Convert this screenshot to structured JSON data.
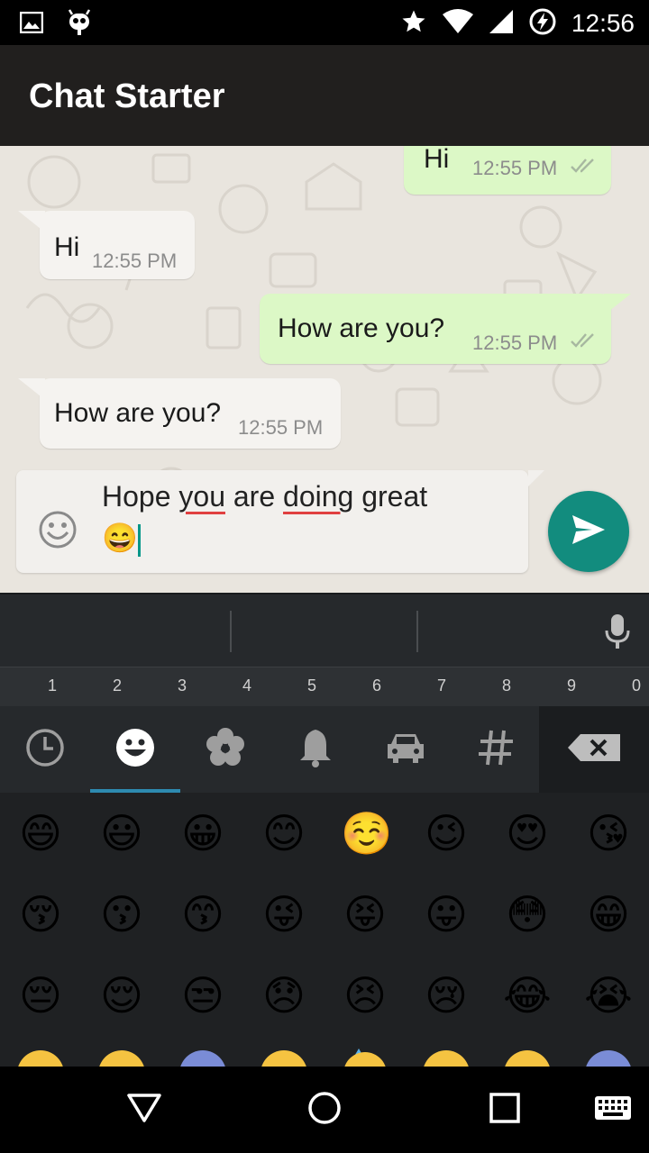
{
  "status_bar": {
    "time": "12:56",
    "icons": [
      "image-icon",
      "android-icon",
      "star-icon",
      "wifi-icon",
      "signal-icon",
      "battery-charging-icon"
    ]
  },
  "app_bar": {
    "title": "Chat Starter"
  },
  "messages": [
    {
      "direction": "outgoing",
      "text": "Hi",
      "time": "12:55 PM",
      "status": "read"
    },
    {
      "direction": "incoming",
      "text": "Hi",
      "time": "12:55 PM"
    },
    {
      "direction": "outgoing",
      "text": "How are you?",
      "time": "12:55 PM",
      "status": "read"
    },
    {
      "direction": "incoming",
      "text": "How are you?",
      "time": "12:55 PM"
    }
  ],
  "composer": {
    "words": [
      "Hope",
      "you",
      "are",
      "doing",
      "great"
    ],
    "emoji": "😄",
    "misspelled": [
      "you",
      "doing"
    ]
  },
  "keyboard": {
    "number_row": [
      "1",
      "2",
      "3",
      "4",
      "5",
      "6",
      "7",
      "8",
      "9",
      "0"
    ],
    "categories": [
      "recent-icon",
      "smiley-icon",
      "flower-icon",
      "bell-icon",
      "car-icon",
      "hash-icon"
    ],
    "active_category": "smiley-icon",
    "emoji_rows": [
      [
        "😄",
        "😃",
        "😀",
        "😊",
        "☺️",
        "😉",
        "😍",
        "😘"
      ],
      [
        "😚",
        "😗",
        "😙",
        "😜",
        "😝",
        "😛",
        "😳",
        "😁"
      ],
      [
        "😔",
        "😌",
        "😒",
        "😞",
        "😣",
        "😢",
        "😂",
        "😭"
      ]
    ]
  },
  "colors": {
    "app_bar": "#211f1e",
    "outgoing_bubble": "#dcf8c6",
    "incoming_bubble": "#f5f3f0",
    "send_button": "#128c7e",
    "read_ticks": "#4fc3f7"
  }
}
